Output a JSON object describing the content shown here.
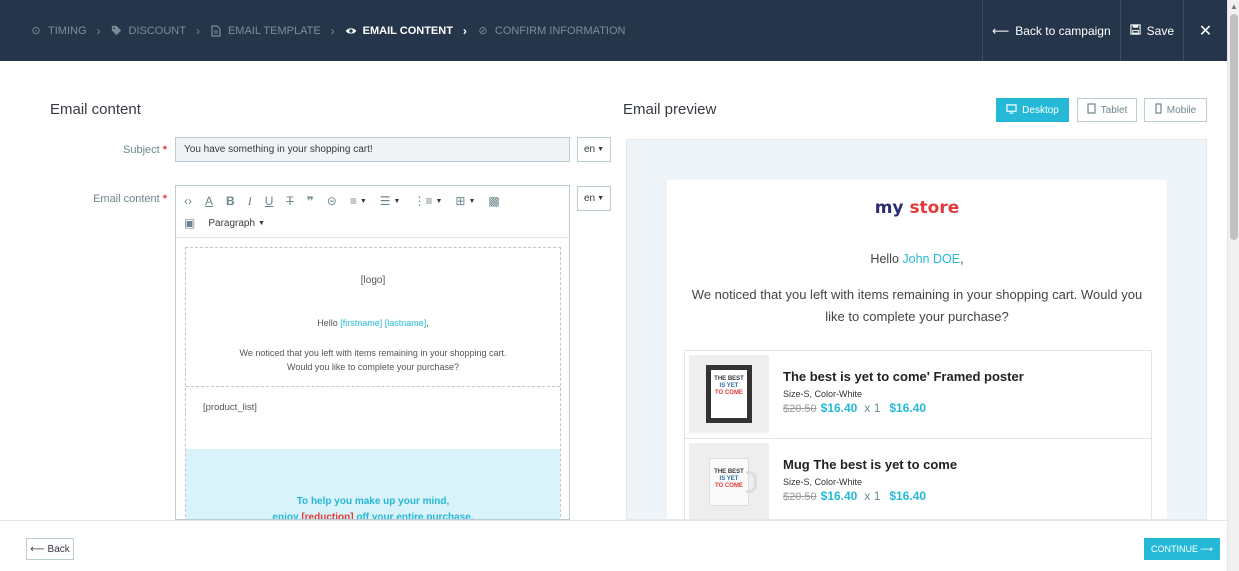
{
  "topbar": {
    "steps": [
      {
        "label": "TIMING",
        "icon": "clock-icon"
      },
      {
        "label": "DISCOUNT",
        "icon": "tag-icon"
      },
      {
        "label": "EMAIL TEMPLATE",
        "icon": "document-icon"
      },
      {
        "label": "EMAIL CONTENT",
        "icon": "eye-icon"
      },
      {
        "label": "CONFIRM INFORMATION",
        "icon": "check-circle-icon"
      }
    ],
    "active_step": "EMAIL CONTENT",
    "back_label": "Back to campaign",
    "save_label": "Save",
    "close_glyph": "✕"
  },
  "editor": {
    "title": "Email content",
    "subject_label": "Subject",
    "subject_value": "You have something in your shopping cart!",
    "content_label": "Email content",
    "required_mark": "*",
    "lang": "en",
    "paragraph_label": "Paragraph",
    "body": {
      "logo": "[logo]",
      "hello_prefix": "Hello",
      "firstname": "[firstname]",
      "lastname": "[lastname]",
      "hello_suffix": ",",
      "notice_line1": "We noticed that you left with items remaining in your shopping cart.",
      "notice_line2": "Would you like to complete your purchase?",
      "product_list": "[product_list]",
      "promo_line1": "To help you make up your mind,",
      "promo_line2_prefix": "enjoy",
      "promo_reduction": "[reduction]",
      "promo_line2_suffix": "off your entire purchase."
    }
  },
  "preview": {
    "title": "Email preview",
    "devices": [
      {
        "label": "Desktop",
        "icon": "monitor-icon",
        "active": true
      },
      {
        "label": "Tablet",
        "icon": "tablet-icon",
        "active": false
      },
      {
        "label": "Mobile",
        "icon": "mobile-icon",
        "active": false
      }
    ],
    "logo_part1": "my",
    "logo_part2": "store",
    "hello_prefix": "Hello",
    "customer_name": "John DOE",
    "hello_suffix": ",",
    "notice": "We noticed that you left with items remaining in your shopping cart. Would you like to complete your purchase?",
    "products": [
      {
        "name": "The best is yet to come' Framed poster",
        "attributes": "Size-S, Color-White",
        "old_price": "$20.50",
        "new_price": "$16.40",
        "qty": "x 1",
        "total": "$16.40"
      },
      {
        "name": "Mug The best is yet to come",
        "attributes": "Size-S, Color-White",
        "old_price": "$20.50",
        "new_price": "$16.40",
        "qty": "x 1",
        "total": "$16.40"
      }
    ],
    "product_art": {
      "line1": "THE BEST",
      "line2": "IS YET",
      "line3": "TO COME"
    }
  },
  "footer": {
    "back_label": "Back",
    "continue_label": "CONTINUE"
  },
  "colors": {
    "topbar_bg": "#25364b",
    "accent": "#25b9d7",
    "required": "#e23b3b"
  }
}
